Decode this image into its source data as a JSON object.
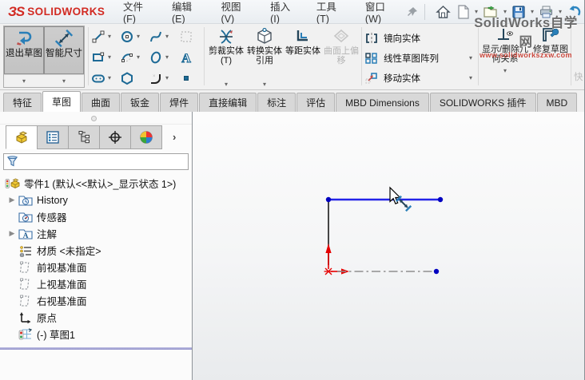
{
  "brand": {
    "glyph": "ЗS",
    "name": "SOLIDWORKS"
  },
  "menubar": {
    "items": [
      {
        "label": "文件(F)"
      },
      {
        "label": "编辑(E)"
      },
      {
        "label": "视图(V)"
      },
      {
        "label": "插入(I)"
      },
      {
        "label": "工具(T)"
      },
      {
        "label": "窗口(W)"
      }
    ]
  },
  "qat": {
    "icons": [
      "home",
      "new-document",
      "open",
      "save",
      "print",
      "undo"
    ]
  },
  "watermark": {
    "title": "SolidWorks自学网",
    "url": "www.solidworkszxw.com"
  },
  "ribbon": {
    "exit_sketch": "退出草图",
    "smart_dimension": "智能尺寸",
    "trim_entities": "剪裁实体(T)",
    "convert_entities": "转换实体引用",
    "offset_entities": "等距实体",
    "offset_on_surface": "曲面上偏移",
    "mirror_entities": "镜向实体",
    "linear_sketch_pattern": "线性草图阵列",
    "move_entities": "移动实体",
    "display_delete_relations": "显示/删除几何关系",
    "repair_sketch": "修复草图",
    "quick_snaps_partial": "快"
  },
  "command_tabs": {
    "active_index": 1,
    "items": [
      {
        "label": "特征"
      },
      {
        "label": "草图"
      },
      {
        "label": "曲面"
      },
      {
        "label": "钣金"
      },
      {
        "label": "焊件"
      },
      {
        "label": "直接编辑"
      },
      {
        "label": "标注"
      },
      {
        "label": "评估"
      },
      {
        "label": "MBD Dimensions"
      },
      {
        "label": "SOLIDWORKS 插件"
      },
      {
        "label": "MBD"
      }
    ]
  },
  "feature_tree": {
    "root": "零件1 (默认<<默认>_显示状态 1>)",
    "items": [
      {
        "label": "History"
      },
      {
        "label": "传感器"
      },
      {
        "label": "注解"
      },
      {
        "label": "材质 <未指定>"
      },
      {
        "label": "前视基准面"
      },
      {
        "label": "上视基准面"
      },
      {
        "label": "右视基准面"
      },
      {
        "label": "原点"
      },
      {
        "label": "(-) 草图1"
      }
    ]
  },
  "canvas": {
    "colors": {
      "selected_line": "#2323e8",
      "sketch_line": "#1a1a1a",
      "origin_marker": "#e60000",
      "centerline": "#8f8f8f",
      "endpoint": "#0000c0"
    }
  }
}
